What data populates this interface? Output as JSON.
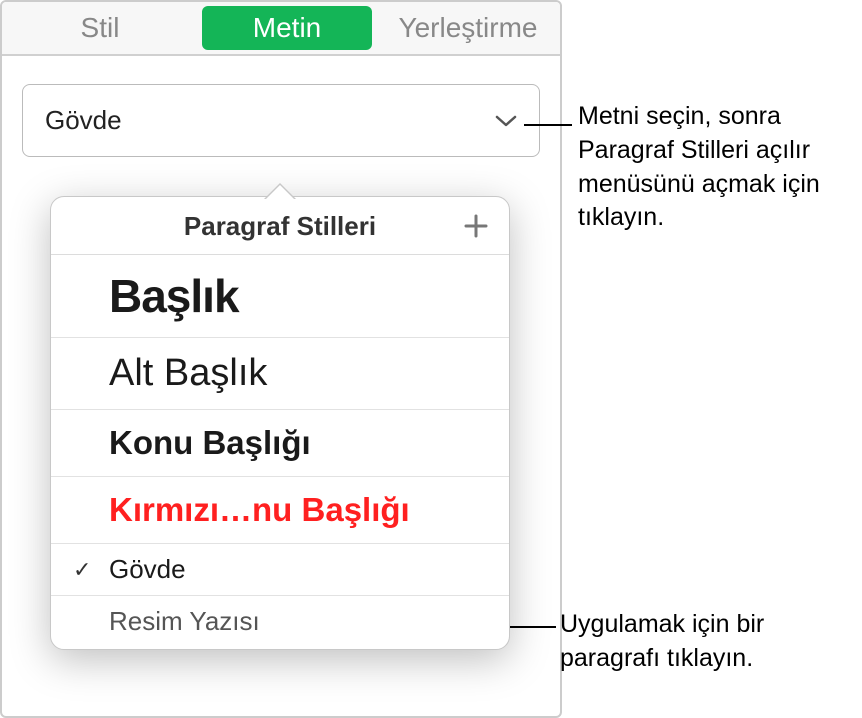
{
  "tabs": {
    "stil": "Stil",
    "metin": "Metin",
    "yerlestirme": "Yerleştirme"
  },
  "styleSelector": {
    "current": "Gövde"
  },
  "popover": {
    "title": "Paragraf Stilleri",
    "items": {
      "baslik": "Başlık",
      "altbaslik": "Alt Başlık",
      "konu": "Konu Başlığı",
      "kirmizi": "Kırmızı…nu Başlığı",
      "govde": "Gövde",
      "resim": "Resim Yazısı"
    }
  },
  "callouts": {
    "c1": "Metni seçin, sonra Paragraf Stilleri açılır menüsünü açmak için tıklayın.",
    "c2": "Uygulamak için bir paragrafı tıklayın."
  },
  "colors": {
    "accent": "#14b557",
    "red": "#ff2020"
  }
}
